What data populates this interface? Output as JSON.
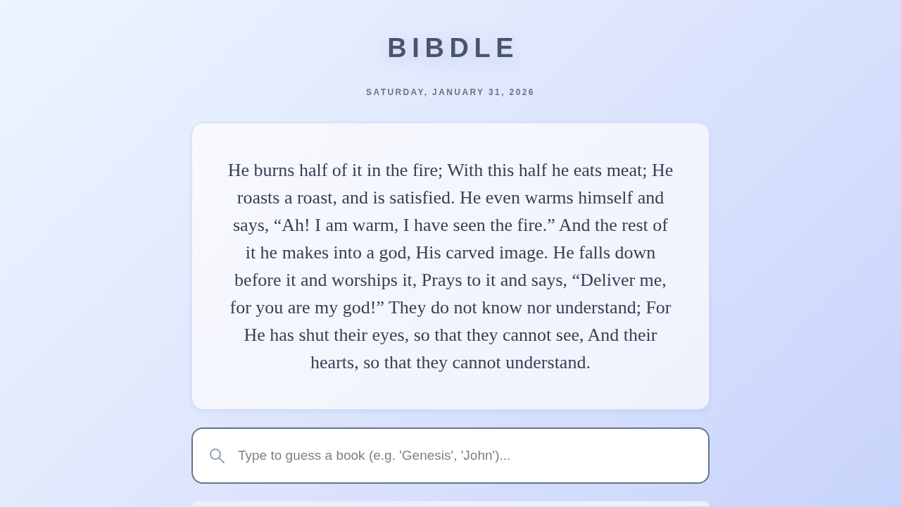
{
  "header": {
    "title": "BIBDLE",
    "date": "SATURDAY, JANUARY 31, 2026"
  },
  "verse": {
    "text": "He burns half of it in the fire; With this half he eats meat; He roasts a roast, and is satisfied. He even warms himself and says, “Ah! I am warm, I have seen the fire.” And the rest of it he makes into a god, His carved image. He falls down before it and worships it, Prays to it and says, “Deliver me, for you are my god!” They do not know nor understand; For He has shut their eyes, so that they cannot see, And their hearts, so that they cannot understand."
  },
  "guess_field": {
    "placeholder": "Type to guess a book (e.g. 'Genesis', 'John')..."
  }
}
